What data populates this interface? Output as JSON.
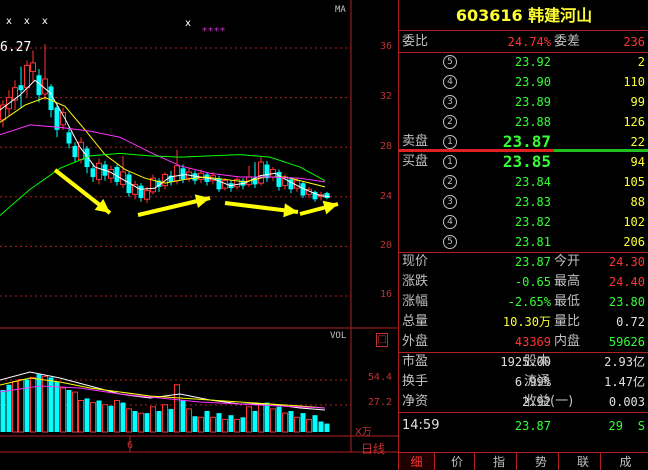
{
  "chart": {
    "ma_label": "MA",
    "vol_label": "VOL",
    "price_callout": "6.27",
    "x_marks": "xxx",
    "x_mark_single": "x",
    "stars": "****",
    "price_axis": [
      "36",
      "32",
      "28",
      "24",
      "20",
      "16"
    ],
    "vol_axis": [
      "54.4",
      "27.2"
    ],
    "vol_unit": "X万",
    "date_tick": "6",
    "period_label": "日线",
    "icon_box": "□",
    "colors": {
      "up": "#ff3333",
      "down": "#00ffff",
      "ma5": "#ffffff",
      "ma10": "#ffff00",
      "ma20": "#ff33ff",
      "ma60": "#00ff00",
      "arrow": "#ffff00",
      "grid": "#b02020"
    }
  },
  "quote": {
    "title": "603616  韩建河山",
    "weibi": {
      "label": "委比",
      "value": "24.74%",
      "label2": "委差",
      "value2": "236"
    },
    "sell": [
      {
        "n": "5",
        "price": "23.92",
        "vol": "2"
      },
      {
        "n": "4",
        "price": "23.90",
        "vol": "110"
      },
      {
        "n": "3",
        "price": "23.89",
        "vol": "99"
      },
      {
        "n": "2",
        "price": "23.88",
        "vol": "126"
      },
      {
        "n": "1",
        "price": "23.87",
        "vol": "22"
      }
    ],
    "sell_label": "卖盘",
    "buy_label": "买盘",
    "buy": [
      {
        "n": "1",
        "price": "23.85",
        "vol": "94"
      },
      {
        "n": "2",
        "price": "23.84",
        "vol": "105"
      },
      {
        "n": "3",
        "price": "23.83",
        "vol": "88"
      },
      {
        "n": "4",
        "price": "23.82",
        "vol": "102"
      },
      {
        "n": "5",
        "price": "23.81",
        "vol": "206"
      }
    ],
    "stats": [
      {
        "l1": "现价",
        "v1": "23.87",
        "l2": "今开",
        "v2": "24.30"
      },
      {
        "l1": "涨跌",
        "v1": "-0.65",
        "l2": "最高",
        "v2": "24.40"
      },
      {
        "l1": "涨幅",
        "v1": "-2.65%",
        "l2": "最低",
        "v2": "23.80"
      },
      {
        "l1": "总量",
        "v1": "10.30万",
        "l2": "量比",
        "v2": "0.72"
      },
      {
        "l1": "外盘",
        "v1": "43369",
        "l2": "内盘",
        "v2": "59626"
      }
    ],
    "fund": [
      {
        "l1": "市盈",
        "v1": "1925.00",
        "l2": "股本",
        "v2": "2.93亿"
      },
      {
        "l1": "换手",
        "v1": "6.99%",
        "l2": "流通",
        "v2": "1.47亿"
      },
      {
        "l1": "净资",
        "v1": "2.92",
        "l2": "收益(一)",
        "v2": "0.003"
      }
    ],
    "tick": {
      "time": "14:59",
      "price": "23.87",
      "vol": "29",
      "side": "S"
    },
    "tabs": [
      "细",
      "价",
      "指",
      "势",
      "联",
      "成"
    ]
  }
}
